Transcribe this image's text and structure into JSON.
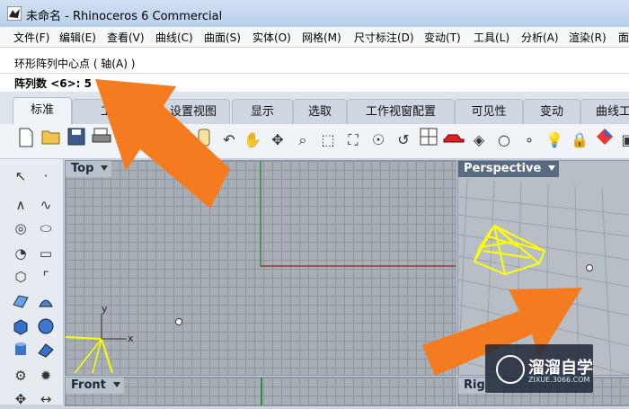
{
  "titlebar": {
    "title": "未命名 - Rhinoceros 6 Commercial",
    "app_icon": "rhino-logo-icon"
  },
  "menubar": {
    "items": [
      "文件(F)",
      "编辑(E)",
      "查看(V)",
      "曲线(C)",
      "曲面(S)",
      "实体(O)",
      "网格(M)",
      "尺寸标注(D)",
      "变动(T)",
      "工具(L)",
      "分析(A)",
      "渲染(R)",
      "面"
    ]
  },
  "command": {
    "prompt": "环形阵列中心点 ( 轴(A) )",
    "input": "阵列数 <6>: 5"
  },
  "tabs": {
    "items": [
      "标准",
      "工作",
      "设置视图",
      "显示",
      "选取",
      "工作视窗配置",
      "可见性",
      "变动",
      "曲线工"
    ],
    "active": "标准"
  },
  "toolbar": {
    "icons": [
      "new-icon",
      "open-icon",
      "save-icon",
      "print-icon",
      "cut-icon",
      "copy-icon",
      "paste-icon",
      "undo-icon",
      "pan-hand-icon",
      "rotate-view-icon",
      "zoom-icon",
      "zoom-window-icon",
      "zoom-extents-icon",
      "zoom-selected-icon",
      "rotate-icon",
      "four-views-icon",
      "car-icon",
      "shaded-icon",
      "circle-icon",
      "points-icon",
      "light-bulb-icon",
      "lock-icon",
      "render-icon"
    ]
  },
  "viewports": {
    "top": {
      "label": "Top"
    },
    "perspective": {
      "label": "Perspective"
    },
    "front": {
      "label": "Front"
    },
    "right": {
      "label": "Rig"
    }
  },
  "axis": {
    "x": "x",
    "y": "y"
  },
  "colors": {
    "arrow": "#f47b20",
    "pyramid": "#ffff00",
    "green_axis": "#2ea043",
    "red_axis": "#b03030"
  },
  "watermark": {
    "name": "溜溜自学",
    "url": "ZIXUE.3066.COM"
  }
}
